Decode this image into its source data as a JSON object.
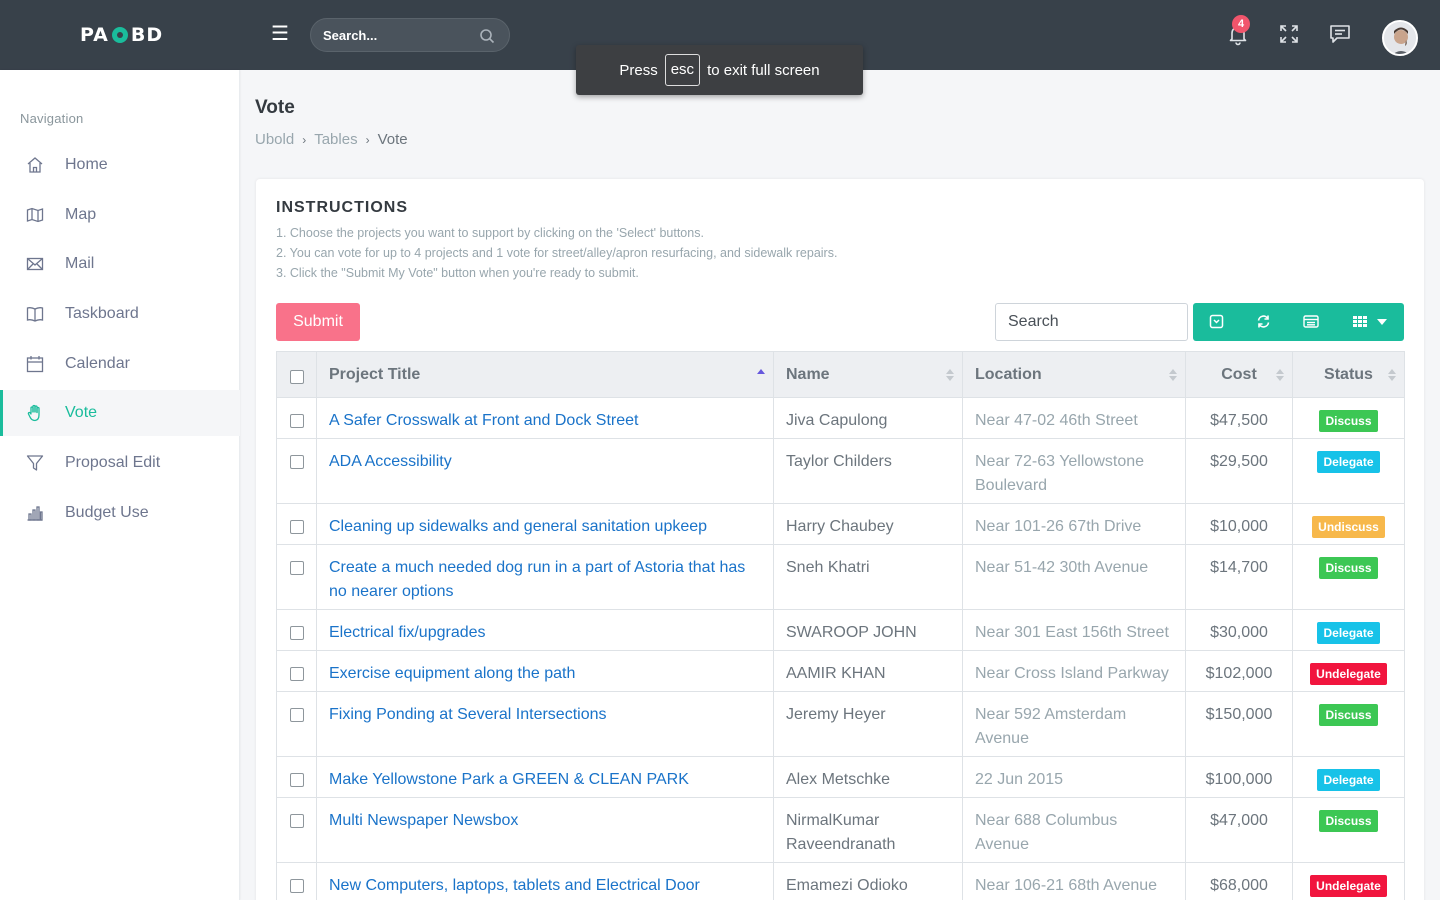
{
  "brand": {
    "left": "PA",
    "right": "BD"
  },
  "topbar": {
    "search_placeholder": "Search...",
    "notification_count": "4"
  },
  "toast": {
    "press": "Press",
    "key": "esc",
    "rest": "to exit full screen"
  },
  "sidebar": {
    "title": "Navigation",
    "items": [
      {
        "label": "Home",
        "icon": "home-icon"
      },
      {
        "label": "Map",
        "icon": "map-icon"
      },
      {
        "label": "Mail",
        "icon": "mail-icon"
      },
      {
        "label": "Taskboard",
        "icon": "book-icon"
      },
      {
        "label": "Calendar",
        "icon": "calendar-icon"
      },
      {
        "label": "Vote",
        "icon": "hand-icon",
        "active": true
      },
      {
        "label": "Proposal Edit",
        "icon": "filter-icon"
      },
      {
        "label": "Budget Use",
        "icon": "bar-chart-icon"
      }
    ]
  },
  "page": {
    "title": "Vote",
    "breadcrumb": [
      "Ubold",
      "Tables",
      "Vote"
    ]
  },
  "instructions": {
    "title": "INSTRUCTIONS",
    "lines": [
      "1. Choose the projects you want to support by clicking on the 'Select' buttons.",
      "2. You can vote for up to 4 projects and 1 vote for street/alley/apron resurfacing, and sidewalk repairs.",
      "3. Click the \"Submit My Vote\" button when you're ready to submit."
    ]
  },
  "toolbar": {
    "submit_label": "Submit",
    "search_placeholder": "Search"
  },
  "table": {
    "columns": [
      "Project Title",
      "Name",
      "Location",
      "Cost",
      "Status"
    ],
    "rows": [
      {
        "title": "A Safer Crosswalk at Front and Dock Street",
        "name": "Jiva Capulong",
        "location": "Near 47-02 46th Street",
        "cost": "$47,500",
        "status": "Discuss"
      },
      {
        "title": "ADA Accessibility",
        "name": "Taylor Childers",
        "location": "Near 72-63 Yellowstone Boulevard",
        "cost": "$29,500",
        "status": "Delegate"
      },
      {
        "title": "Cleaning up sidewalks and general sanitation upkeep",
        "name": "Harry Chaubey",
        "location": "Near 101-26 67th Drive",
        "cost": "$10,000",
        "status": "Undiscuss"
      },
      {
        "title": "Create a much needed dog run in a part of Astoria that has no nearer options",
        "name": "Sneh Khatri",
        "location": "Near 51-42 30th Avenue",
        "cost": "$14,700",
        "status": "Discuss"
      },
      {
        "title": "Electrical fix/upgrades",
        "name": "SWAROOP JOHN",
        "location": "Near 301 East 156th Street",
        "cost": "$30,000",
        "status": "Delegate"
      },
      {
        "title": "Exercise equipment along the path",
        "name": "AAMIR KHAN",
        "location": "Near Cross Island Parkway",
        "cost": "$102,000",
        "status": "Undelegate"
      },
      {
        "title": "Fixing Ponding at Several Intersections",
        "name": "Jeremy Heyer",
        "location": "Near 592 Amsterdam Avenue",
        "cost": "$150,000",
        "status": "Discuss"
      },
      {
        "title": "Make Yellowstone Park a GREEN & CLEAN PARK",
        "name": "Alex Metschke",
        "location": "22 Jun 2015",
        "cost": "$100,000",
        "status": "Delegate"
      },
      {
        "title": "Multi Newspaper Newsbox",
        "name": "NirmalKumar Raveendranath",
        "location": "Near 688 Columbus Avenue",
        "cost": "$47,000",
        "status": "Discuss"
      },
      {
        "title": "New Computers, laptops, tablets and Electrical Door",
        "name": "Emamezi Odioko",
        "location": "Near 106-21 68th Avenue",
        "cost": "$68,000",
        "status": "Undelegate"
      }
    ]
  },
  "colors": {
    "topbar": "#38414a",
    "accent": "#1abc9c",
    "submit": "#f9728a",
    "link": "#1a73c9",
    "status_discuss": "#3cc754",
    "status_delegate": "#17c2e8",
    "status_undiscuss": "#f7b84b",
    "status_undelegate": "#f1153e"
  }
}
